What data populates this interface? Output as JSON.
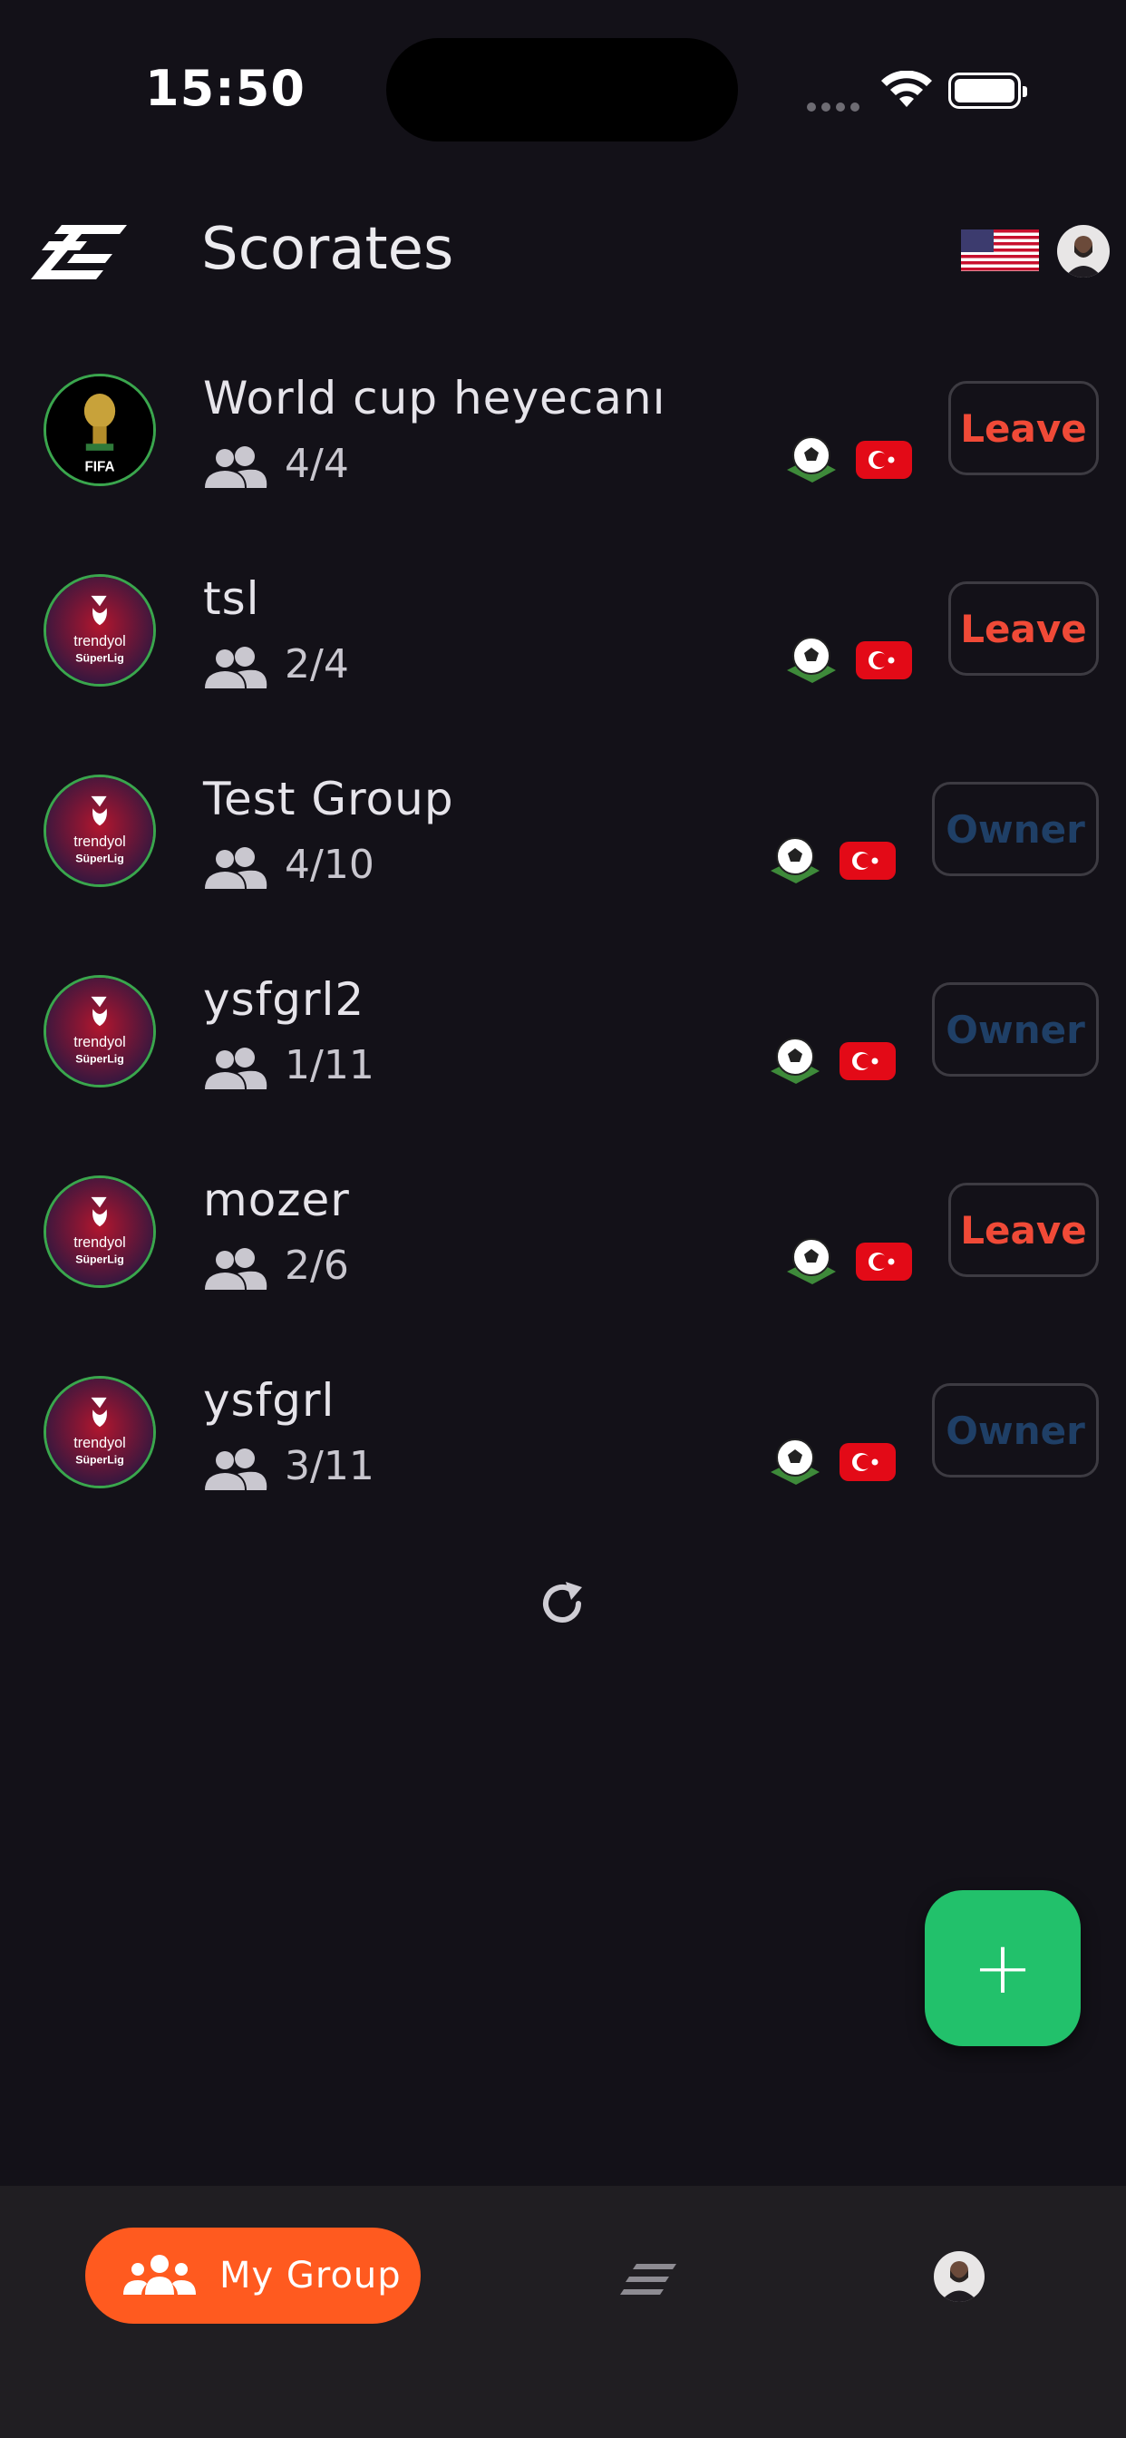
{
  "status": {
    "time": "15:50"
  },
  "header": {
    "title": "Scorates"
  },
  "groups": [
    {
      "name": "World cup heyecanı",
      "members": "4/4",
      "action": "Leave",
      "logo": "fifa-world-cup"
    },
    {
      "name": "tsl",
      "members": "2/4",
      "action": "Leave",
      "logo": "trendyol-superlig"
    },
    {
      "name": "Test Group",
      "members": "4/10",
      "action": "Owner",
      "logo": "trendyol-superlig"
    },
    {
      "name": "ysfgrl2",
      "members": "1/11",
      "action": "Owner",
      "logo": "trendyol-superlig"
    },
    {
      "name": "mozer",
      "members": "2/6",
      "action": "Leave",
      "logo": "trendyol-superlig"
    },
    {
      "name": "ysfgrl",
      "members": "3/11",
      "action": "Owner",
      "logo": "trendyol-superlig"
    }
  ],
  "logo_text": {
    "fifa": "FIFA",
    "trendyol": "trendyol",
    "superlig": "SüperLig"
  },
  "fab": {
    "label": "+"
  },
  "nav": {
    "my_group": "My Group"
  },
  "colors": {
    "background": "#131118",
    "leave": "#f04a37",
    "owner": "#1f3f66",
    "fab": "#22c16b",
    "nav_active": "#ff5a1f",
    "logo_ring": "#3aa64d"
  }
}
